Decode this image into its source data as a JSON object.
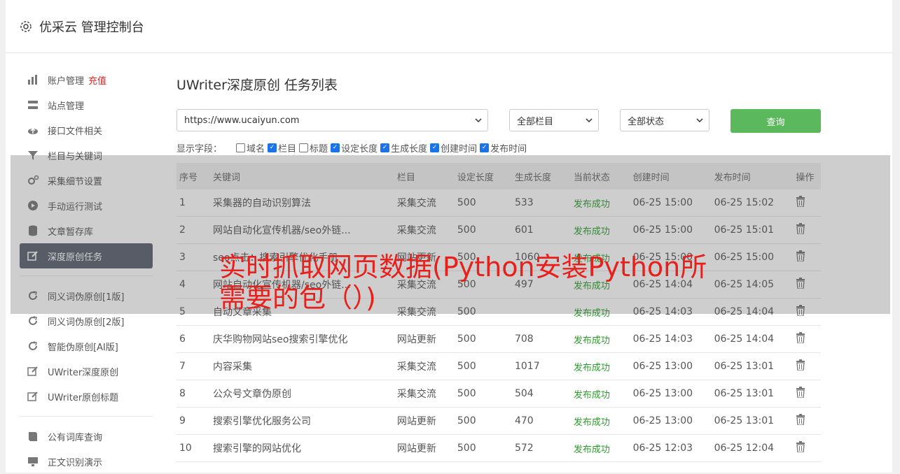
{
  "app": {
    "title": "优采云 管理控制台"
  },
  "sidebar": {
    "group1": [
      {
        "label": "账户管理",
        "icon": "bar-chart-icon",
        "badge": "充值"
      },
      {
        "label": "站点管理",
        "icon": "server-icon"
      },
      {
        "label": "接口文件相关",
        "icon": "cloud-upload-icon"
      },
      {
        "label": "栏目与关键词",
        "icon": "filter-icon"
      },
      {
        "label": "采集细节设置",
        "icon": "cogs-icon"
      },
      {
        "label": "手动运行测试",
        "icon": "play-circle-icon"
      },
      {
        "label": "文章暂存库",
        "icon": "database-icon"
      },
      {
        "label": "深度原创任务",
        "icon": "edit-icon",
        "active": true
      }
    ],
    "group2": [
      {
        "label": "同义词伪原创[1版]",
        "icon": "refresh-icon"
      },
      {
        "label": "同义词伪原创[2版]",
        "icon": "refresh-icon"
      },
      {
        "label": "智能伪原创[AI版]",
        "icon": "refresh-icon"
      },
      {
        "label": "UWriter深度原创",
        "icon": "edit-icon"
      },
      {
        "label": "UWriter原创标题",
        "icon": "edit-icon"
      }
    ],
    "group3": [
      {
        "label": "公有词库查询",
        "icon": "book-icon"
      },
      {
        "label": "正文识别演示",
        "icon": "monitor-icon"
      }
    ]
  },
  "main": {
    "title": "UWriter深度原创 任务列表",
    "site_select": "https://www.ucaiyun.com",
    "column_select": "全部栏目",
    "status_select": "全部状态",
    "query_label": "查询",
    "fields_label": "显示字段：",
    "fields": [
      {
        "label": "域名",
        "checked": false
      },
      {
        "label": "栏目",
        "checked": true
      },
      {
        "label": "标题",
        "checked": false
      },
      {
        "label": "设定长度",
        "checked": true
      },
      {
        "label": "生成长度",
        "checked": true
      },
      {
        "label": "创建时间",
        "checked": true
      },
      {
        "label": "发布时间",
        "checked": true
      }
    ],
    "columns": [
      "序号",
      "关键词",
      "栏目",
      "设定长度",
      "生成长度",
      "当前状态",
      "创建时间",
      "发布时间",
      "操作"
    ],
    "rows": [
      [
        "1",
        "采集器的自动识别算法",
        "采集交流",
        "500",
        "533",
        "发布成功",
        "06-25 15:00",
        "06-25 15:02"
      ],
      [
        "2",
        "网站自动化宣传机器/seo外链...",
        "采集交流",
        "500",
        "601",
        "发布成功",
        "06-25 15:00",
        "06-25 15:01"
      ],
      [
        "3",
        "seo点击：搜索引擎优化手册",
        "网站更新",
        "500",
        "1060",
        "发布成功",
        "06-25 15:00",
        "06-25 15:00"
      ],
      [
        "4",
        "网站自动化宣传机器/seo外链...",
        "采集交流",
        "500",
        "497",
        "发布成功",
        "06-25 14:04",
        "06-25 14:05"
      ],
      [
        "5",
        "自动文章采集",
        "采集交流",
        "500",
        "",
        "发布成功",
        "06-25 14:03",
        "06-25 14:04"
      ],
      [
        "6",
        "庆华购物网站seo搜索引擎优化",
        "网站更新",
        "500",
        "708",
        "发布成功",
        "06-25 14:03",
        "06-25 14:04"
      ],
      [
        "7",
        "内容采集",
        "采集交流",
        "500",
        "1017",
        "发布成功",
        "06-25 13:00",
        "06-25 13:01"
      ],
      [
        "8",
        "公众号文章伪原创",
        "采集交流",
        "500",
        "504",
        "发布成功",
        "06-25 13:00",
        "06-25 13:01"
      ],
      [
        "9",
        "搜索引擎优化服务公司",
        "网站更新",
        "500",
        "470",
        "发布成功",
        "06-25 13:00",
        "06-25 13:01"
      ],
      [
        "10",
        "搜索引擎的网站优化",
        "网站更新",
        "500",
        "572",
        "发布成功",
        "06-25 12:03",
        "06-25 12:04"
      ]
    ]
  },
  "overlay": {
    "text": "实时抓取网页数据(Python安装Python所需要的包（）)",
    "color": "#e8201c"
  }
}
